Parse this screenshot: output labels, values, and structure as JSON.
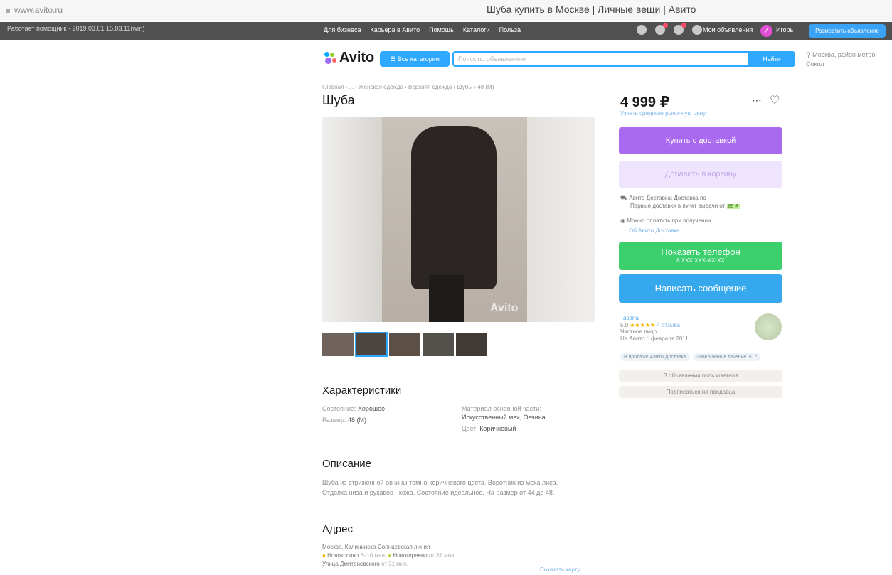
{
  "browser": {
    "url": "www.avito.ru",
    "page_title": "Шуба купить в Москве | Личные вещи | Авито"
  },
  "topbar": {
    "saved_text": "Работает помощник · 2019.03.01 15.03.11(wm)",
    "nav": [
      "Для бизнеса",
      "Карьера в Авито",
      "Помощь",
      "Каталоги",
      "Польза"
    ],
    "my_ads": "Мои объявления",
    "avatar_letter": "И",
    "username": "Игорь",
    "post_button": "Разместить объявление"
  },
  "header": {
    "logo": "Avito",
    "categories_button": "☰ Все категории",
    "search_placeholder": "Поиск по объявлениям",
    "find_button": "Найти",
    "location": "Москва, район метро Сокол"
  },
  "listing": {
    "breadcrumb": "Главная › ... › Женская одежда › Верхняя одежда › Шубы › 48 (M)",
    "title": "Шуба",
    "watermark": "Avito",
    "price": "4 999 ₽",
    "price_link": "Узнать среднюю рыночную цену",
    "buy_button": "Купить с доставкой",
    "cart_button": "Добавить в корзину",
    "delivery_line1": "Авито Доставка: Доставка по",
    "delivery_line2": "Первые доставки в пункт выдачи от",
    "delivery_badge": "89 ₽",
    "pay_line": "Можно оплатить при получении",
    "pay_link": "Об Авито Доставке",
    "phone_button": "Показать телефон",
    "phone_sub": "8 XXX XXX-XX-XX",
    "message_button": "Написать сообщение",
    "seller": {
      "name": "Tatiana",
      "rating": "5.0",
      "stars": "★★★★★",
      "reviews": "4 отзыва",
      "type": "Частное лицо",
      "since": "На Авито с февраля 2011"
    },
    "tags": [
      "В продаже Авито Доставка",
      "Завершено в течение 30 с"
    ],
    "subscribe_note": "В объявлении пользователя",
    "subscribe_button": "Подписаться на продавца"
  },
  "characteristics": {
    "title": "Характеристики",
    "left": [
      {
        "label": "Состояние:",
        "value": "Хорошее"
      },
      {
        "label": "Размер:",
        "value": "48 (M)"
      }
    ],
    "right": [
      {
        "label": "Материал основной части:",
        "value": "Искусственный мех, Овчина"
      },
      {
        "label": "Цвет:",
        "value": "Коричневый"
      }
    ]
  },
  "description": {
    "title": "Описание",
    "line1": "Шуба из стриженной овчины темно-коричневого цвета. Воротник из меха лиса.",
    "line2": "Отделка низа и рукавов - кожа. Состояние идеальное. На размер от 44 до 48."
  },
  "address": {
    "title": "Адрес",
    "line1": "Москва, Калининско-Солнцевская линия",
    "metro1": "Новокосино",
    "metro1_dur": "6–10 мин.",
    "metro2": "Новогиреево",
    "metro2_dur": "от 31 мин.",
    "line3": "Улица Дмитриевского",
    "line3_dur": "от 31 мин.",
    "map_link": "Показать карту"
  },
  "colors": {
    "accent": "#2fa9ff",
    "buy": "#a96af0",
    "phone": "#3ccf6e",
    "message": "#35a8ee"
  }
}
